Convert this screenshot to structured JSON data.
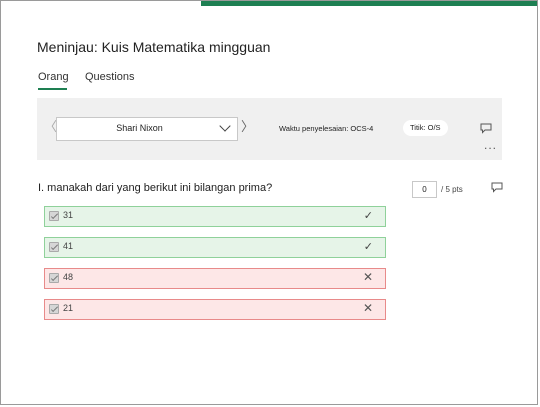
{
  "header": {
    "title": "Meninjau: Kuis Matematika mingguan"
  },
  "tabs": [
    {
      "label": "Orang",
      "active": true
    },
    {
      "label": "Questions",
      "active": false
    }
  ],
  "toolbar": {
    "respondent": "Shari Nixon",
    "completion_time": "Waktu penyelesaian: OCS-4",
    "score": "Titik: O/S",
    "more_glyph": "...",
    "prev_glyph": "〈",
    "next_glyph": "〉"
  },
  "question": {
    "text": "I. manakah dari yang berikut ini bilangan prima?",
    "points_value": "0",
    "points_suffix": "/ 5 pts",
    "options": [
      {
        "label": "31",
        "status": "correct",
        "mark": "✓"
      },
      {
        "label": "41",
        "status": "correct",
        "mark": "✓"
      },
      {
        "label": "48",
        "status": "wrong",
        "mark": "✕"
      },
      {
        "label": "21",
        "status": "wrong",
        "mark": "✕"
      }
    ]
  },
  "colors": {
    "accent": "#1e7f52",
    "correct_bg": "#e6f4e8",
    "correct_border": "#8fd19a",
    "wrong_bg": "#fde7e7",
    "wrong_border": "#e88a8a"
  }
}
